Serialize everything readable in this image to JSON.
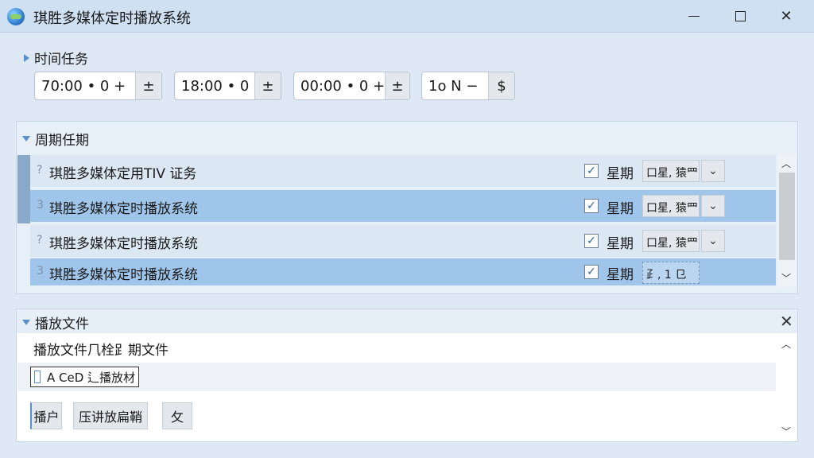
{
  "window": {
    "title": "琪胜多媒体定时播放系统"
  },
  "time_section": {
    "header": "时间任务",
    "spinners": [
      {
        "value": "70:00 •  0 +",
        "button": "±"
      },
      {
        "value": "18:00 •  0",
        "button": "±"
      },
      {
        "value": "00:00 •  0 +",
        "button": "±"
      },
      {
        "value": "1o N  −",
        "button": "$"
      }
    ]
  },
  "period_section": {
    "header": "周期任期",
    "rows": [
      {
        "num": "?",
        "text": "琪胜多媒体定用TIV 证务",
        "checked": true,
        "label": "星期",
        "combo": "⼝星, 猿⺫",
        "drop": "⌄"
      },
      {
        "num": "3",
        "text": "琪胜多媒体定时播放系统",
        "checked": true,
        "label": "星期",
        "combo": "⼝星, 猿⺫",
        "drop": "⌄"
      },
      {
        "num": "?",
        "text": "琪胜多媒体定时播放系统",
        "checked": true,
        "label": "星期",
        "combo": "⼝星, 猿⺫",
        "drop": "⌄"
      },
      {
        "num": "3",
        "text": "琪胜多媒体定时播放系统",
        "checked": true,
        "label": "星期",
        "combo": "⺪, 1 ⺋",
        "drop": ""
      }
    ]
  },
  "file_section": {
    "header": "播放文件",
    "description": "播放文件⺇栓⻊期文件",
    "file_item": "A CeD ⻍播放材",
    "buttons": [
      "播户",
      "压讲放扁鞘",
      "⺙"
    ]
  },
  "icons": {
    "collapse": "triangle-down-icon",
    "expand": "triangle-right-icon",
    "check": "checkmark-icon",
    "close": "close-icon"
  },
  "colors": {
    "accent": "#5b8fd0",
    "row_highlight": "#9fc5ea",
    "row_normal": "#dce7f4"
  }
}
